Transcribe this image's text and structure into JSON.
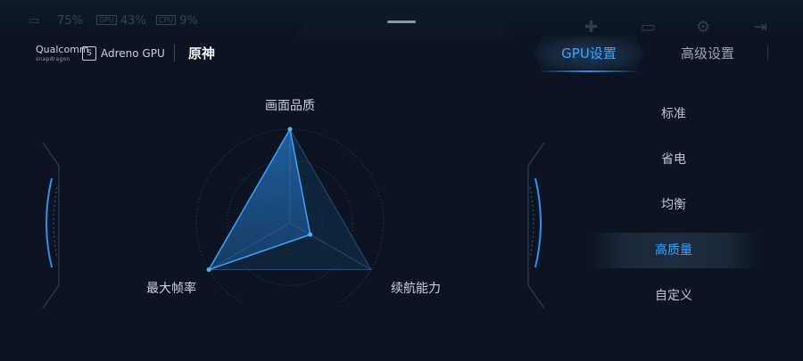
{
  "status": {
    "cpu_label": "75%",
    "gpu_chip": "GPU",
    "gpu_label": "43%",
    "mem_chip": "CPU",
    "mem_label": "9%"
  },
  "brand": {
    "qualcomm": "Qualcomm",
    "snapdragon": "snapdragon",
    "badge": "S",
    "gpu_name": "Adreno GPU",
    "game_title": "原神"
  },
  "tabs": [
    {
      "label": "GPU设置",
      "active": true
    },
    {
      "label": "高级设置",
      "active": false
    }
  ],
  "radar": {
    "axes": [
      {
        "label": "画面品质",
        "value": 1.0
      },
      {
        "label": "续航能力",
        "value": 0.25
      },
      {
        "label": "最大帧率",
        "value": 1.0
      }
    ]
  },
  "modes": [
    {
      "label": "标准",
      "selected": false
    },
    {
      "label": "省电",
      "selected": false
    },
    {
      "label": "均衡",
      "selected": false
    },
    {
      "label": "高质量",
      "selected": true
    },
    {
      "label": "自定义",
      "selected": false
    }
  ],
  "colors": {
    "accent": "#3aa3ff",
    "background": "#0c1421"
  }
}
